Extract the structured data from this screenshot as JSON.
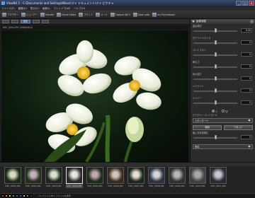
{
  "window": {
    "title": "ViewNX 2 - C:\\Documents and Settings\\Nikon\\マイ ドキュメント\\マイ ピクチャ",
    "min": "_",
    "max": "□",
    "close": "×"
  },
  "menubar": {
    "items": [
      "ファイル(F)",
      "編集(E)",
      "表示(V)",
      "画像(I)",
      "ウィンドウ(W)",
      "ヘルプ(H)"
    ]
  },
  "toolbar": {
    "items": [
      {
        "label": "ブラウザー",
        "icon": "browser-icon"
      },
      {
        "label": "ビューアー",
        "icon": "viewer-icon"
      },
      {
        "label": "Transfer",
        "icon": "transfer-icon"
      },
      {
        "label": "Movie Editor",
        "icon": "movie-icon"
      },
      {
        "label": "プリント",
        "icon": "print-icon"
      },
      {
        "label": "メール",
        "icon": "mail-icon"
      },
      {
        "label": "Capture NX 2",
        "icon": "capture-icon"
      },
      {
        "label": "Open with",
        "icon": "open-with-icon"
      },
      {
        "label": "my Picturetown",
        "icon": "picturetown-icon"
      }
    ],
    "view_mode": "表示"
  },
  "path_bar": {
    "text": "DSC_0001.JPG  2009/04/12"
  },
  "right_panel": {
    "header": "画像調整",
    "rows": [
      {
        "label": "露出補正",
        "value": "0.00"
      },
      {
        "label": "ホワイトバランス",
        "value": "0"
      },
      {
        "label": "コントラスト",
        "value": "0"
      },
      {
        "label": "明るさ",
        "value": "0"
      },
      {
        "label": "色の濃さ",
        "value": "0"
      },
      {
        "label": "ハイライト",
        "value": "0"
      },
      {
        "label": "シャドー",
        "value": "0"
      }
    ],
    "radio_options": [
      "入",
      "切"
    ],
    "radio_selected": "入",
    "select_label": "ピクチャーコントロール",
    "select_value": "スタンダード",
    "apply_label": "適用",
    "reset_label": "リセット",
    "extra_row": {
      "label": "軸上色収差補正",
      "value": "0"
    },
    "footer_select": "標準"
  },
  "filmstrip": {
    "items": [
      {
        "caption": "DSC_0001.JPG",
        "selected": false
      },
      {
        "caption": "DSC_0002.JPG",
        "selected": false
      },
      {
        "caption": "DSC_0003.JPG",
        "selected": false
      },
      {
        "caption": "DSC_0004.JPG",
        "selected": true
      },
      {
        "caption": "DSC_0005.JPG",
        "selected": false
      },
      {
        "caption": "DSC_0006.JPG",
        "selected": false
      },
      {
        "caption": "DSC_0007.JPG",
        "selected": false
      },
      {
        "caption": "DSC_0008.JPG",
        "selected": false
      },
      {
        "caption": "DSC_0009.JPG",
        "selected": false
      },
      {
        "caption": "DSC_0010.JPG",
        "selected": false
      },
      {
        "caption": "DSC_0011.JPG",
        "selected": false
      }
    ]
  },
  "statusbar": {
    "swatches": [
      "#e03030",
      "#e08a30",
      "#e0d030",
      "#40b040",
      "#3070d0",
      "#8040c0",
      "#c0c0c0",
      "#808080",
      "#404040"
    ],
    "text": "11 ファイル中 1 ファイルを選択"
  }
}
